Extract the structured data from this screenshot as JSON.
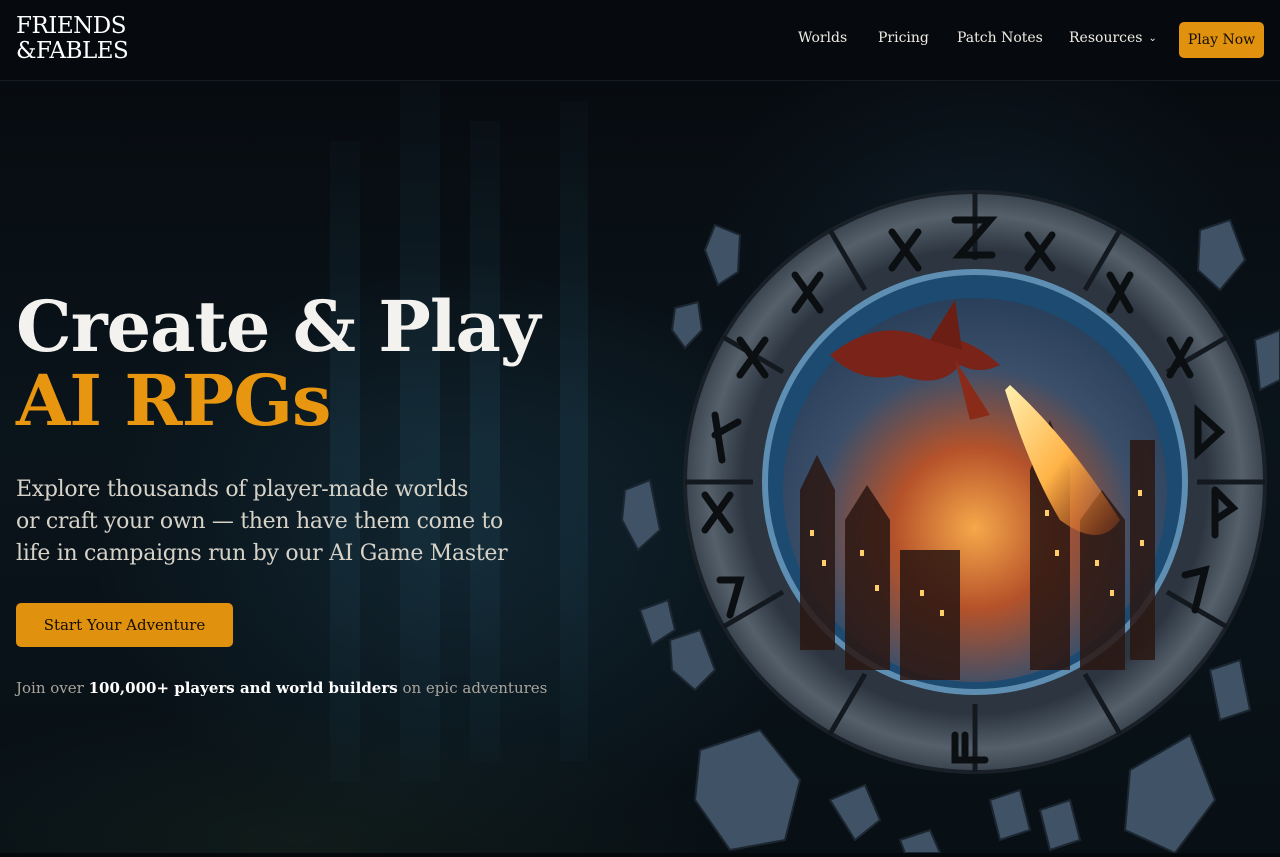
{
  "brand": {
    "line1": "FRIENDS",
    "line2": "&FABLES"
  },
  "nav": {
    "worlds": "Worlds",
    "pricing": "Pricing",
    "patch_notes": "Patch Notes",
    "resources": "Resources",
    "play_now": "Play Now"
  },
  "hero": {
    "title_line1": "Create & Play",
    "title_line2": "AI RPGs",
    "description_line1": "Explore thousands of player-made worlds",
    "description_line2": "or craft your own — then have them come to",
    "description_line3": "life in campaigns run by our AI Game Master",
    "cta": "Start Your Adventure",
    "social_prefix": "Join over ",
    "social_bold": "100,000+ players and world builders",
    "social_suffix": " on epic adventures"
  },
  "colors": {
    "accent": "#e0910e",
    "title_accent": "#e8950f",
    "background": "#05090d"
  },
  "icons": {
    "resources_dropdown": "chevron-down-icon"
  }
}
